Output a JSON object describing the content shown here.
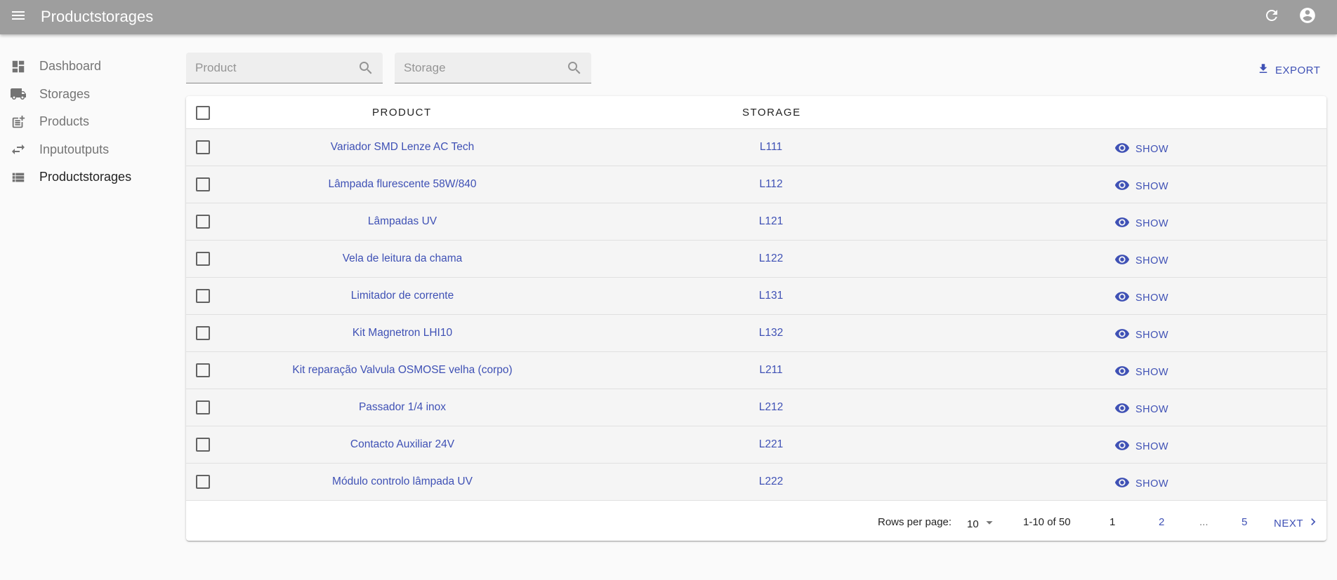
{
  "appbar": {
    "title": "Productstorages",
    "icons": {
      "menu": "menu-icon",
      "refresh": "refresh-icon",
      "account": "account-circle-icon"
    }
  },
  "sidebar": {
    "items": [
      {
        "label": "Dashboard",
        "icon": "dashboard-icon",
        "active": false
      },
      {
        "label": "Storages",
        "icon": "truck-icon",
        "active": false
      },
      {
        "label": "Products",
        "icon": "post-add-icon",
        "active": false
      },
      {
        "label": "Inputoutputs",
        "icon": "swap-horiz-icon",
        "active": false
      },
      {
        "label": "Productstorages",
        "icon": "view-list-icon",
        "active": true
      }
    ]
  },
  "filters": {
    "product_placeholder": "Product",
    "product_value": "",
    "storage_placeholder": "Storage",
    "storage_value": ""
  },
  "toolbar": {
    "export_label": "EXPORT"
  },
  "table": {
    "headers": {
      "product": "PRODUCT",
      "storage": "STORAGE"
    },
    "show_label": "SHOW",
    "rows": [
      {
        "product": "Variador SMD Lenze AC Tech",
        "storage": "L111"
      },
      {
        "product": "Lâmpada flurescente 58W/840",
        "storage": "L112"
      },
      {
        "product": "Lâmpadas UV",
        "storage": "L121"
      },
      {
        "product": "Vela de leitura da chama",
        "storage": "L122"
      },
      {
        "product": "Limitador de corrente",
        "storage": "L131"
      },
      {
        "product": "Kit Magnetron LHI10",
        "storage": "L132"
      },
      {
        "product": "Kit reparação Valvula OSMOSE velha (corpo)",
        "storage": "L211"
      },
      {
        "product": "Passador 1/4 inox",
        "storage": "L212"
      },
      {
        "product": "Contacto Auxiliar 24V",
        "storage": "L221"
      },
      {
        "product": "Módulo controlo lâmpada UV",
        "storage": "L222"
      }
    ]
  },
  "pagination": {
    "rows_per_page_label": "Rows per page:",
    "rows_per_page_value": "10",
    "range": "1-10 of 50",
    "pages": [
      "1",
      "2",
      "...",
      "5"
    ],
    "current_page": "1",
    "next_label": "NEXT"
  },
  "colors": {
    "appbar": "#9e9e9e",
    "accent": "#3f51b5",
    "row_bg": "#f5f5f5"
  }
}
